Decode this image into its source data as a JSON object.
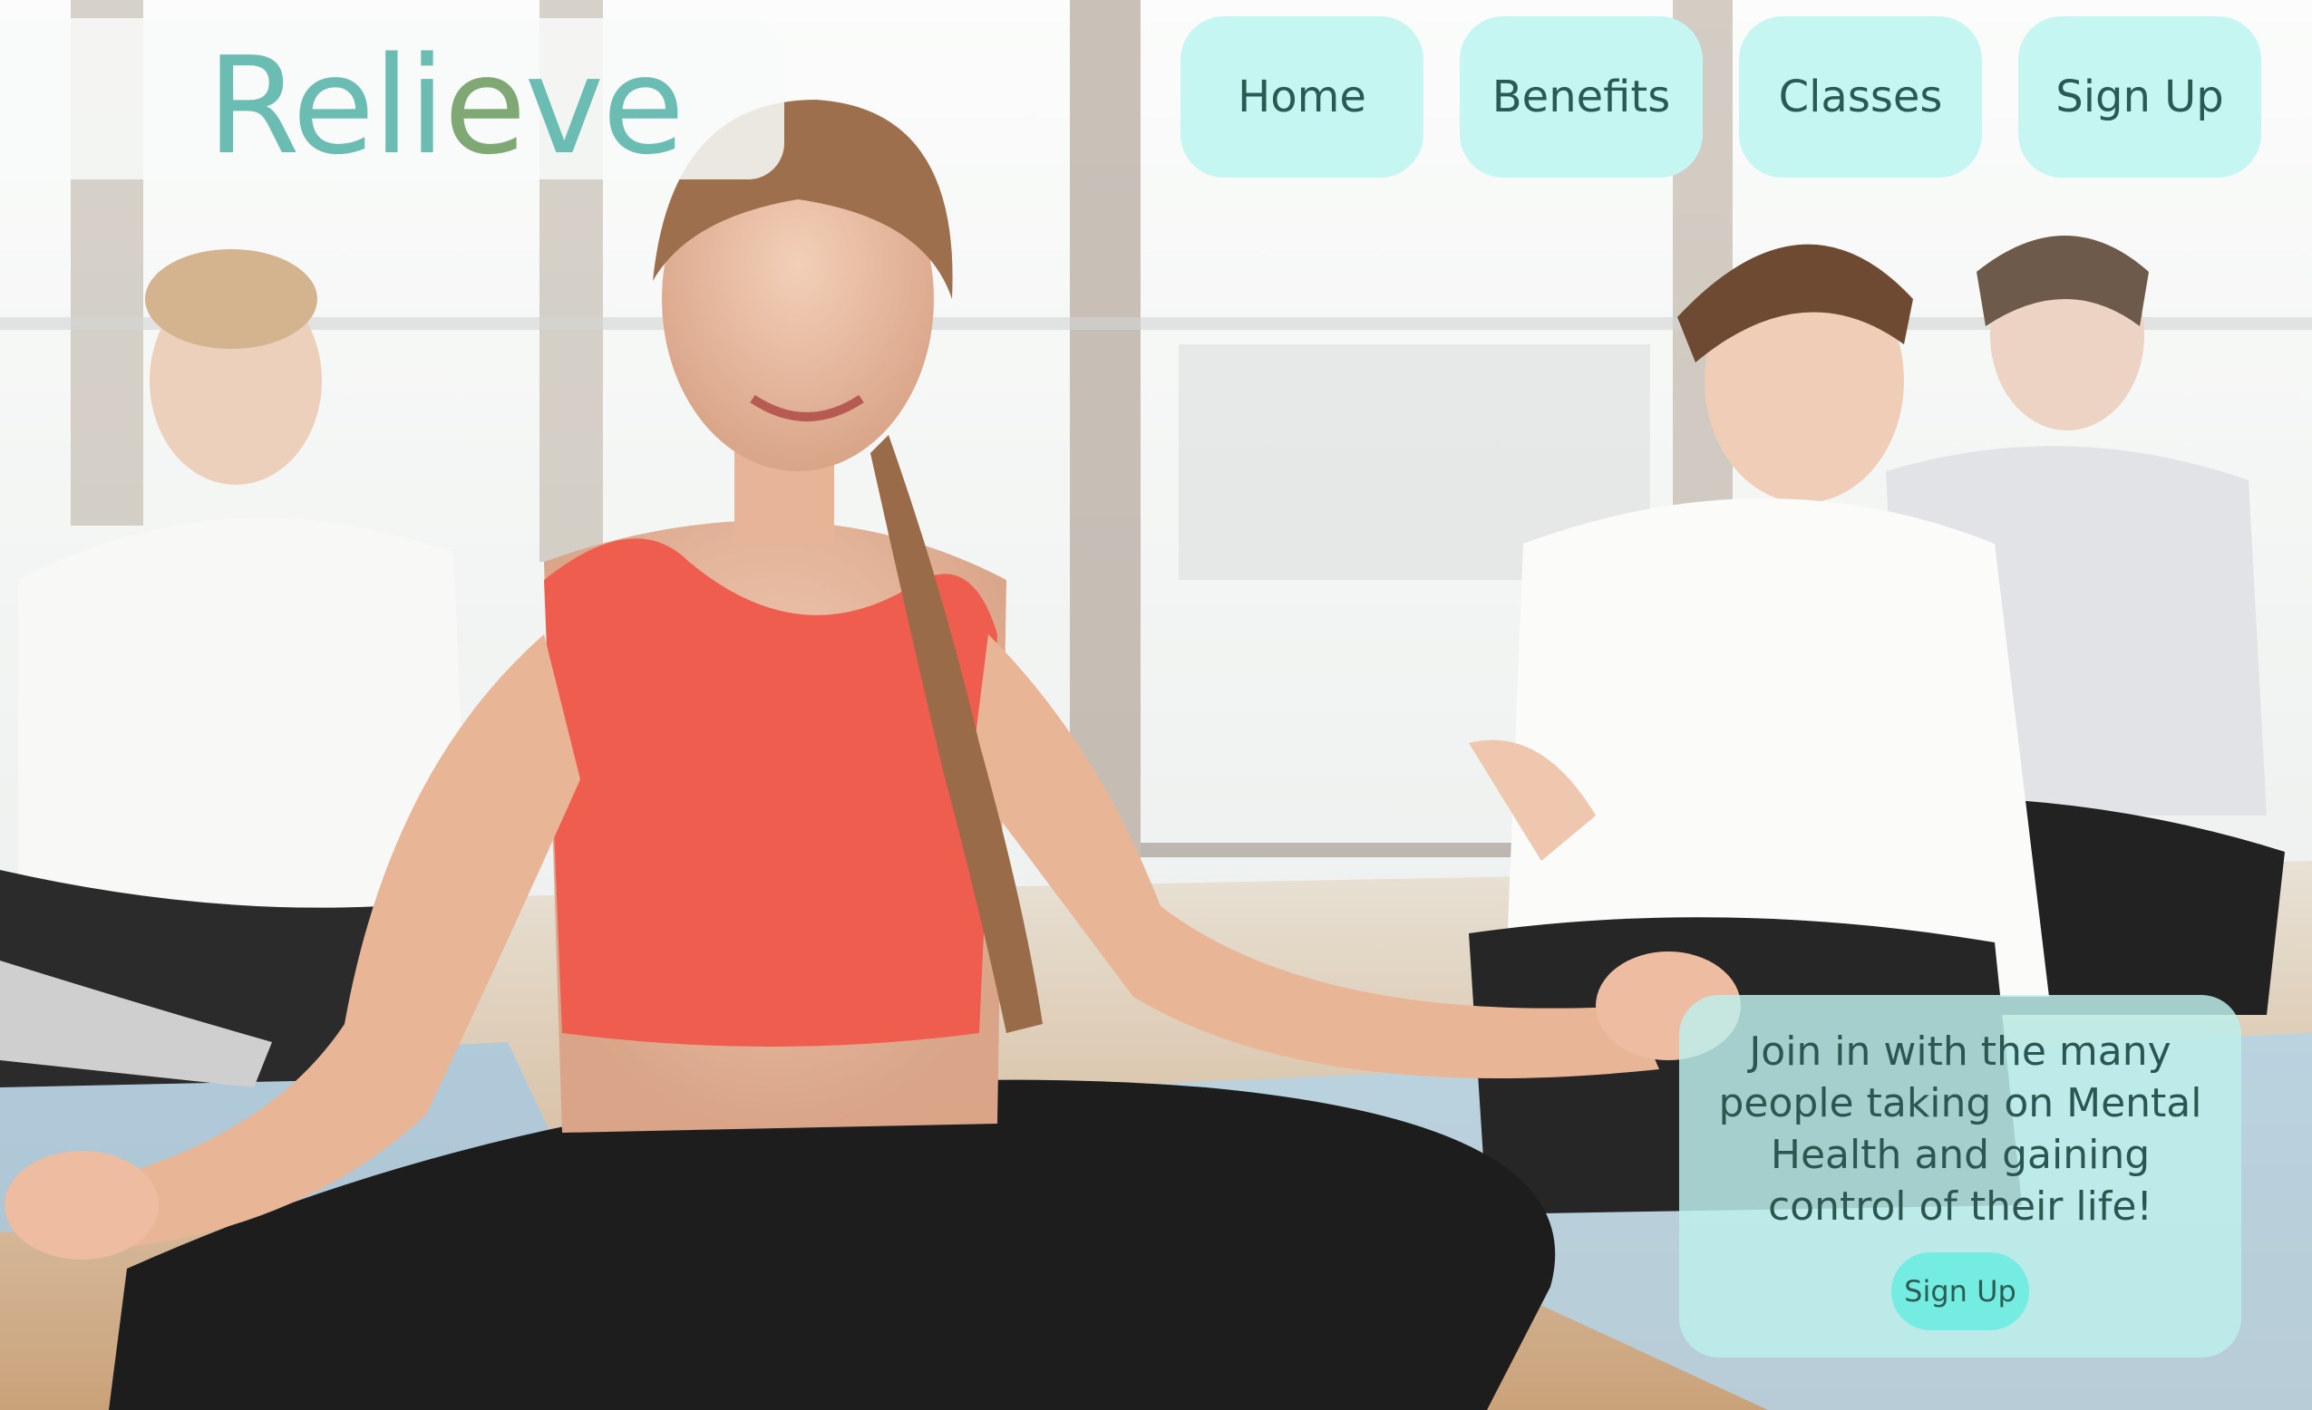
{
  "brand": {
    "logo_prefix": "Reli",
    "logo_accent": "e",
    "logo_suffix": "ve"
  },
  "nav": {
    "items": [
      {
        "label": "Home"
      },
      {
        "label": "Benefits"
      },
      {
        "label": "Classes"
      },
      {
        "label": "Sign Up"
      }
    ]
  },
  "cta": {
    "text": "Join in with the many people taking on Mental Health and gaining control of their life!",
    "button_label": "Sign Up"
  },
  "colors": {
    "logo": "#6bbcb3",
    "logo_accent": "#7fa874",
    "nav_button": "#c6f6f2",
    "nav_text": "#2a5a52",
    "cta_card": "#bcf0ec",
    "cta_button": "#74ece1"
  },
  "hero_image": {
    "subject": "yoga-class-photo"
  }
}
